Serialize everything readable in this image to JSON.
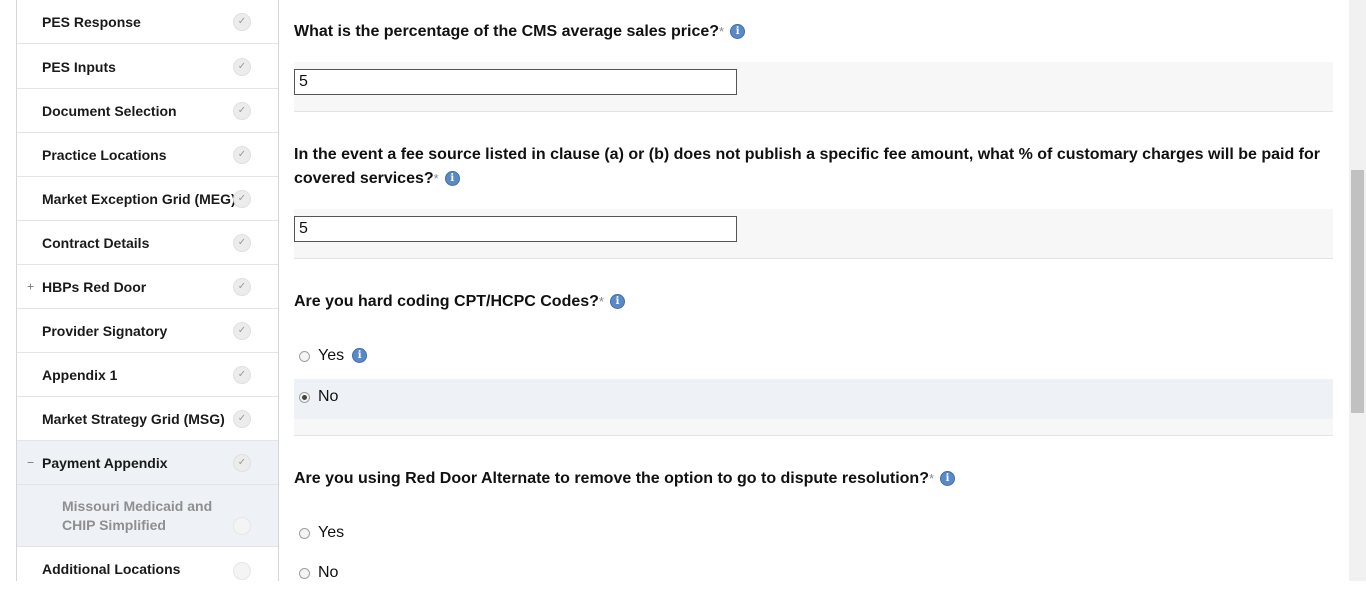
{
  "sidebar": {
    "items": [
      {
        "label": "PES Response"
      },
      {
        "label": "PES Inputs"
      },
      {
        "label": "Document Selection"
      },
      {
        "label": "Practice Locations"
      },
      {
        "label": "Market Exception Grid (MEG)"
      },
      {
        "label": "Contract Details"
      },
      {
        "label": "HBPs Red Door",
        "expander": "+"
      },
      {
        "label": "Provider Signatory"
      },
      {
        "label": "Appendix 1"
      },
      {
        "label": "Market Strategy Grid (MSG)"
      },
      {
        "label": "Payment Appendix",
        "expander": "−"
      },
      {
        "label": "Missouri Medicaid and CHIP Simplified"
      },
      {
        "label": "Additional Locations"
      }
    ],
    "check_glyph": "✓"
  },
  "questions": {
    "q1": {
      "text": "What is the percentage of the CMS average sales price?",
      "value": "5"
    },
    "q2": {
      "text": "In the event a fee source listed in clause (a) or (b) does not publish a specific fee amount, what % of customary charges will be paid for covered services?",
      "value": "5"
    },
    "q3": {
      "text": "Are you hard coding CPT/HCPC Codes?",
      "options": [
        "Yes",
        "No"
      ],
      "selected": "No"
    },
    "q4": {
      "text": "Are you using Red Door Alternate to remove the option to go to dispute resolution?",
      "options": [
        "Yes",
        "No"
      ]
    }
  },
  "required_marker": "*",
  "info_glyph": "i"
}
